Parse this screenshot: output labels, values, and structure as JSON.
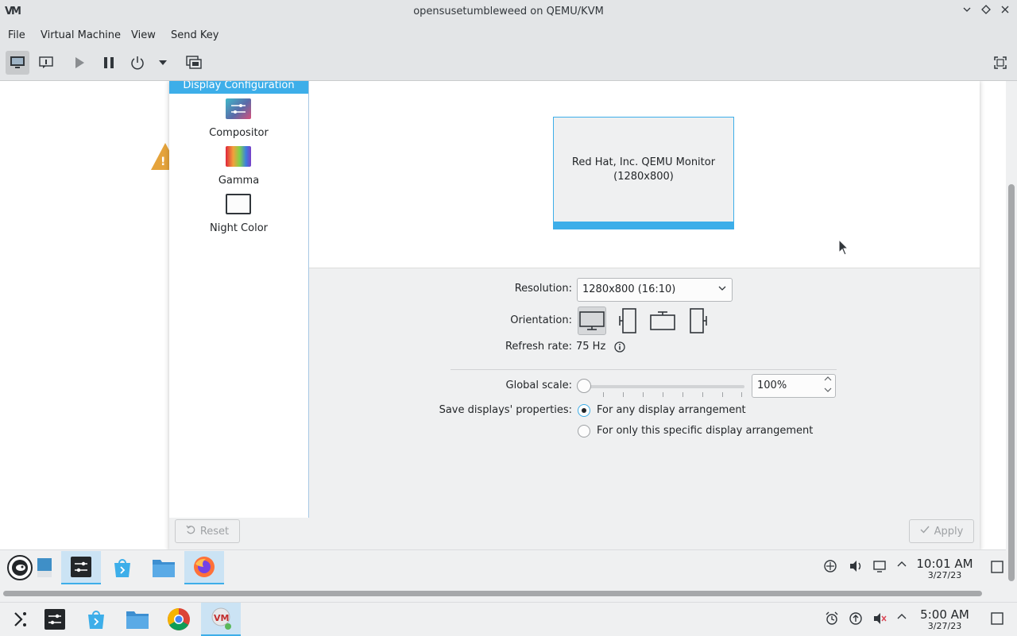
{
  "host": {
    "logo": "VM",
    "title": "opensusetumbleweed on QEMU/KVM",
    "menu": [
      "File",
      "Virtual Machine",
      "View",
      "Send Key"
    ],
    "toolbar_icons": [
      "monitor-icon",
      "info-icon",
      "play-icon",
      "pause-icon",
      "power-icon",
      "dropdown-icon",
      "screenshot-icon",
      "fullscreen-icon"
    ]
  },
  "settings": {
    "sidebar_selected": "Display Configuration",
    "sidebar_items": [
      {
        "label": "Compositor",
        "icon": "compositor-icon"
      },
      {
        "label": "Gamma",
        "icon": "gamma-icon"
      },
      {
        "label": "Night Color",
        "icon": "night-color-icon"
      }
    ],
    "monitor": {
      "name": "Red Hat, Inc. QEMU Monitor",
      "resolution": "(1280x800)"
    },
    "resolution_label": "Resolution:",
    "resolution_value": "1280x800 (16:10)",
    "orientation_label": "Orientation:",
    "refresh_label": "Refresh rate:",
    "refresh_value": "75 Hz",
    "global_scale_label": "Global scale:",
    "global_scale_value": "100%",
    "global_scale_fraction": 0.0,
    "save_label": "Save displays' properties:",
    "radio_any": "For any display arrangement",
    "radio_specific": "For only this specific display arrangement",
    "radio_selected": "any",
    "reset_label": "Reset",
    "apply_label": "Apply"
  },
  "guest_panel": {
    "time": "10:01 AM",
    "date": "3/27/23"
  },
  "host_panel": {
    "time": "5:00 AM",
    "date": "3/27/23"
  },
  "colors": {
    "accent": "#3daee9",
    "warning": "#e5a33b"
  }
}
